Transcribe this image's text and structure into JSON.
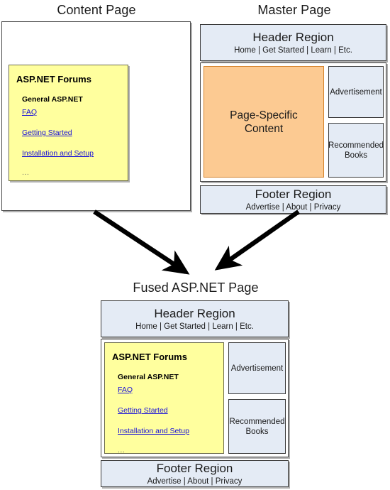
{
  "diagram": {
    "titles": {
      "content_page": "Content Page",
      "master_page": "Master Page",
      "fused_page": "Fused ASP.NET Page"
    }
  },
  "forums": {
    "title": "ASP.NET Forums",
    "category": "General ASP.NET",
    "links": [
      "FAQ",
      "Getting Started",
      "Installation and Setup"
    ],
    "ellipsis": "..."
  },
  "master": {
    "header": {
      "title": "Header Region",
      "nav": "Home | Get Started | Learn | Etc."
    },
    "content": {
      "label_line1": "Page-Specific",
      "label_line2": "Content"
    },
    "advertisement": {
      "label": "Advertisement"
    },
    "books": {
      "label_line1": "Recommended",
      "label_line2": "Books"
    },
    "footer": {
      "title": "Footer Region",
      "nav": "Advertise | About | Privacy"
    }
  },
  "fused": {
    "header": {
      "title": "Header Region",
      "nav": "Home | Get Started | Learn | Etc."
    },
    "advertisement": {
      "label": "Advertisement"
    },
    "books": {
      "label_line1": "Recommended",
      "label_line2": "Books"
    },
    "footer": {
      "title": "Footer Region",
      "nav": "Advertise | About | Privacy"
    }
  },
  "colors": {
    "region_fill": "#e4ebf5",
    "forums_fill": "#ffff9e",
    "content_fill": "#fcca92",
    "link": "#1a12d8",
    "arrow": "#000000"
  }
}
